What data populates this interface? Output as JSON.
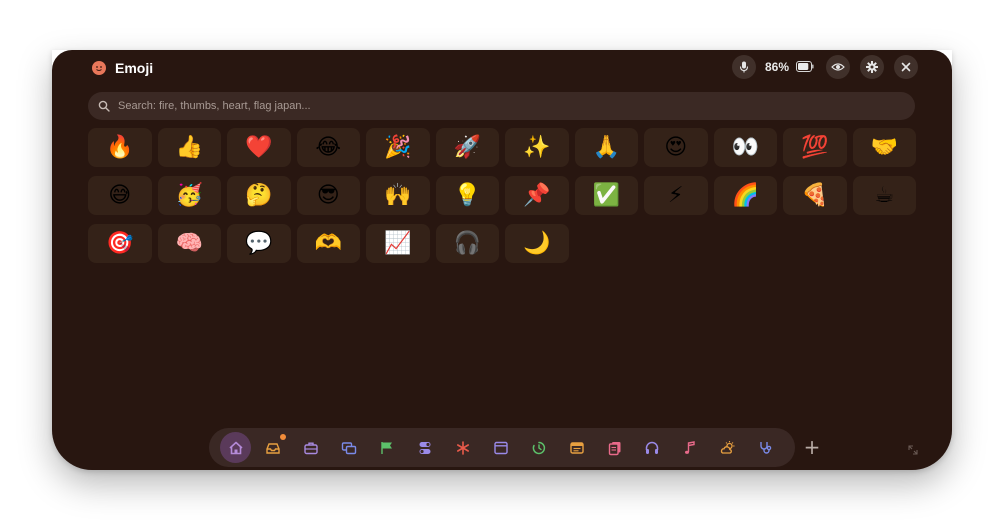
{
  "window": {
    "title": "Emoji",
    "title_icon": "emoji-face-icon",
    "battery_percent": "86%",
    "battery_level": 0.86,
    "controls": [
      "mic-icon",
      "eye-icon",
      "gear-icon",
      "close-icon"
    ]
  },
  "search": {
    "placeholder": "Search: fire, thumbs, heart, flag japan..."
  },
  "emojis": [
    "🔥",
    "👍",
    "❤️",
    "😂",
    "🎉",
    "🚀",
    "✨",
    "🙏",
    "😍",
    "👀",
    "💯",
    "🤝",
    "😅",
    "🥳",
    "🤔",
    "😎",
    "🙌",
    "💡",
    "📌",
    "✅",
    "⚡",
    "🌈",
    "🍕",
    "☕",
    "🎯",
    "🧠",
    "💬",
    "🫶",
    "📈",
    "🎧",
    "🌙"
  ],
  "dock": {
    "items": [
      {
        "icon": "home-icon",
        "color": "#b48ad8",
        "active": true
      },
      {
        "icon": "inbox-icon",
        "color": "#e8a040",
        "badge": true
      },
      {
        "icon": "briefcase-icon",
        "color": "#a88ae0"
      },
      {
        "icon": "windows-icon",
        "color": "#7a8ae8"
      },
      {
        "icon": "flag-icon",
        "color": "#5cc06a"
      },
      {
        "icon": "toggle-icon",
        "color": "#9a8ae8"
      },
      {
        "icon": "asterisk-icon",
        "color": "#e85a4a"
      },
      {
        "icon": "browser-icon",
        "color": "#9a8ae8"
      },
      {
        "icon": "timer-icon",
        "color": "#5cc06a"
      },
      {
        "icon": "notes-icon",
        "color": "#e8a040"
      },
      {
        "icon": "clipboard-icon",
        "color": "#e86a8a"
      },
      {
        "icon": "headphones-icon",
        "color": "#9a8ae8"
      },
      {
        "icon": "music-note-icon",
        "color": "#e86a8a"
      },
      {
        "icon": "weather-icon",
        "color": "#e8a040"
      },
      {
        "icon": "stethoscope-icon",
        "color": "#7a8ae8"
      }
    ],
    "add_label": "+"
  }
}
